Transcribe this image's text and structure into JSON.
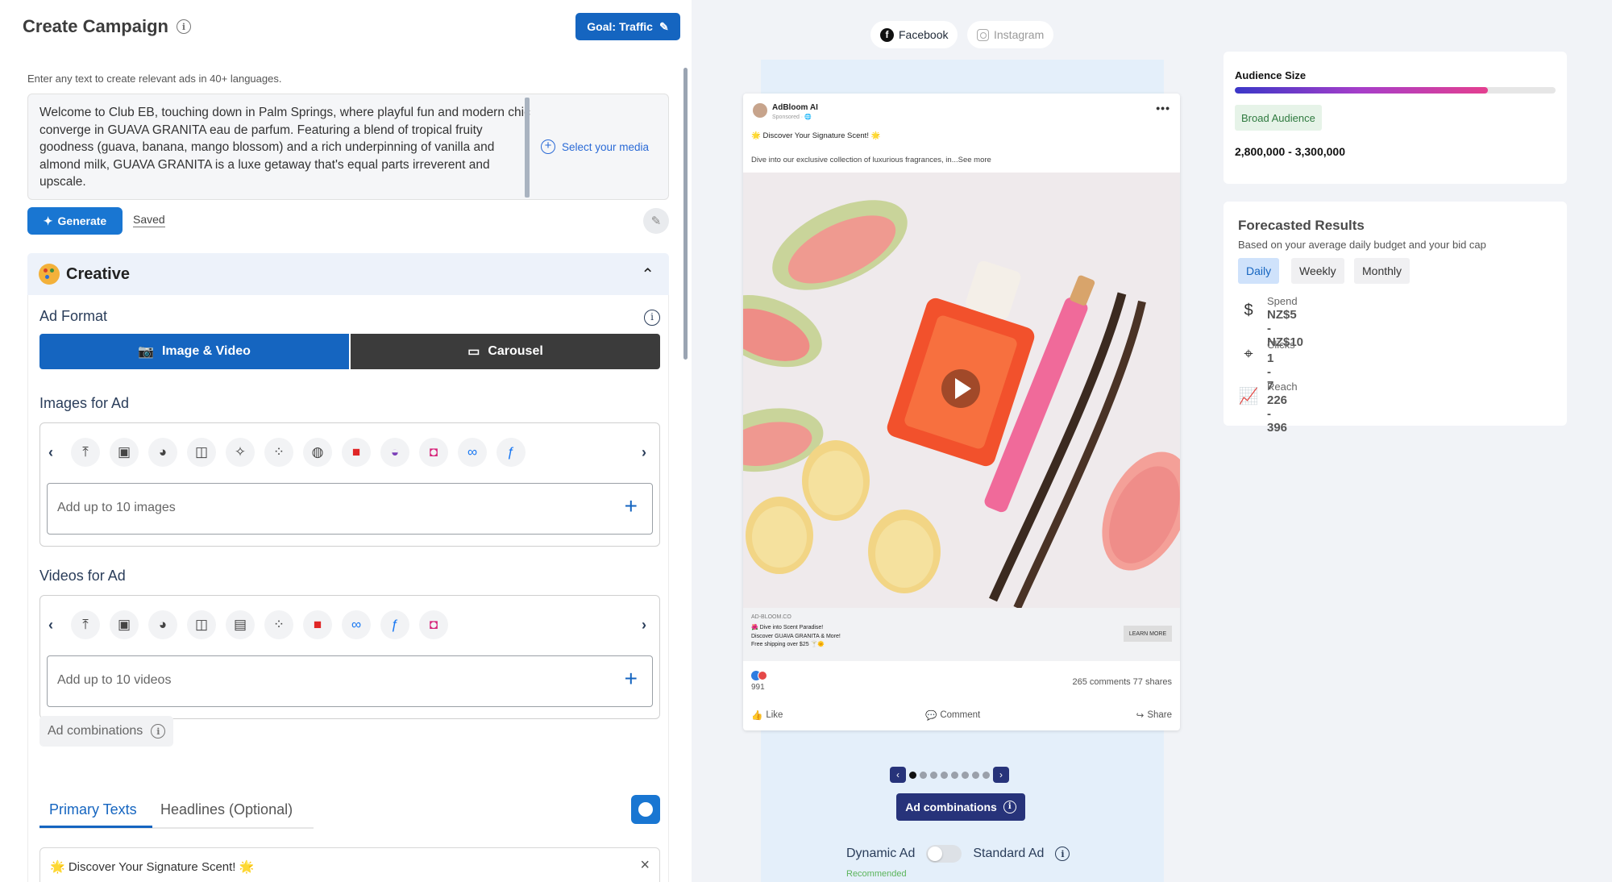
{
  "left": {
    "title": "Create Campaign",
    "goal_button": "Goal: Traffic",
    "hint": "Enter any text to create relevant ads in 40+ languages.",
    "prompt_text": "Welcome to Club EB, touching down in Palm Springs, where playful fun and modern chic converge in GUAVA GRANITA eau de parfum. Featuring a blend of tropical fruity goodness (guava, banana, mango blossom) and a rich underpinning of vanilla and almond milk, GUAVA GRANITA is a luxe getaway that's equal parts irreverent and upscale.",
    "select_media": "Select your media",
    "generate": "Generate",
    "saved": "Saved",
    "creative": {
      "title": "Creative",
      "ad_format_label": "Ad Format",
      "format_image_video": "Image & Video",
      "format_carousel": "Carousel",
      "images_label": "Images for Ad",
      "images_placeholder": "Add up to 10 images",
      "videos_label": "Videos for Ad",
      "videos_placeholder": "Add up to 10 videos",
      "ad_combinations": "Ad combinations",
      "tab_primary": "Primary Texts",
      "tab_headlines": "Headlines (Optional)",
      "primary_text_1": "🌟 Discover Your Signature Scent! 🌟"
    }
  },
  "right": {
    "platform_facebook": "Facebook",
    "platform_instagram": "Instagram",
    "post": {
      "page_name": "AdBloom AI",
      "sponsored": "Sponsored · 🌐",
      "line1": "🌟 Discover Your Signature Scent! 🌟",
      "line2": "Dive into our exclusive collection of luxurious fragrances, in...See more",
      "domain": "AD-BLOOM.CO",
      "cta_line1": "🌺 Dive into Scent Paradise!",
      "cta_line2": "Discover GUAVA GRANITA & More!",
      "cta_line3": "Free shipping over $25 🍸🌞",
      "learn_more": "LEARN MORE",
      "reactions": "991",
      "comments_shares": "265 comments  77 shares",
      "like": "Like",
      "comment": "Comment",
      "share": "Share"
    },
    "ad_combinations": "Ad combinations",
    "dynamic_ad": "Dynamic Ad",
    "standard_ad": "Standard Ad",
    "recommended": "Recommended"
  },
  "audience": {
    "title": "Audience Size",
    "fill_fraction": 0.79,
    "badge": "Broad Audience",
    "range": "2,800,000 - 3,300,000"
  },
  "forecast": {
    "title": "Forecasted Results",
    "subtitle": "Based on your average daily budget and your bid cap",
    "daily": "Daily",
    "weekly": "Weekly",
    "monthly": "Monthly",
    "spend_label": "Spend",
    "spend_value": "NZ$5 - NZ$10",
    "clicks_label": "Clicks",
    "clicks_value": "1 - 7",
    "reach_label": "Reach",
    "reach_value": "226 - 396"
  },
  "colors": {
    "primary": "#1565c0",
    "navy": "#27337a",
    "dark_button": "#3b3b3b",
    "recommended": "#5bb45b"
  }
}
